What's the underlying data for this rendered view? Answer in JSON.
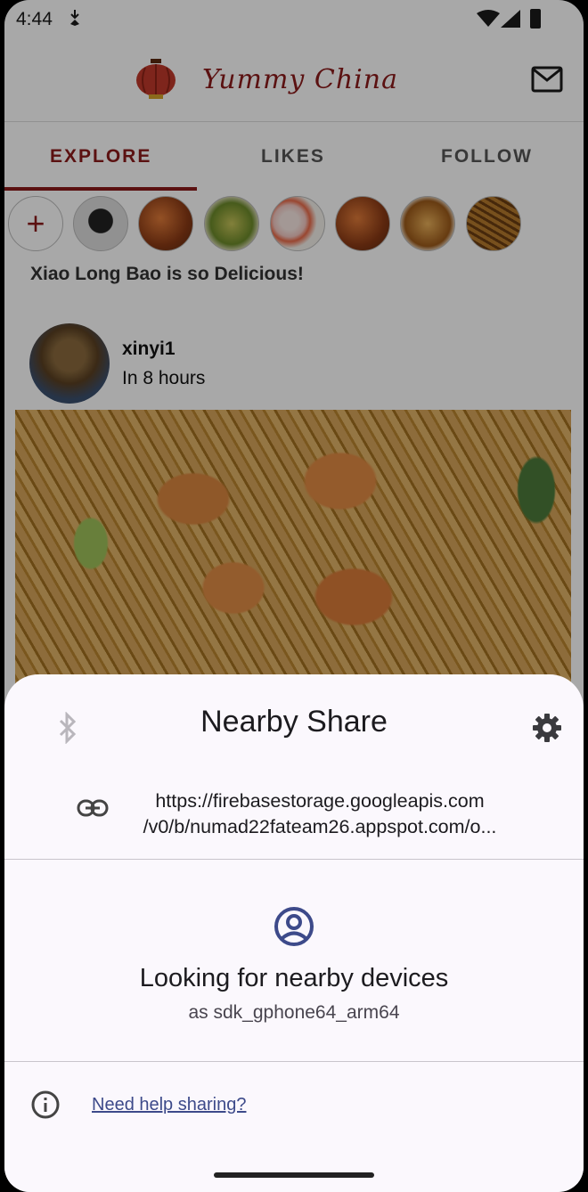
{
  "status_bar": {
    "time": "4:44"
  },
  "app": {
    "title": "Yummy China"
  },
  "tabs": [
    {
      "label": "EXPLORE",
      "active": true
    },
    {
      "label": "LIKES",
      "active": false
    },
    {
      "label": "FOLLOW",
      "active": false
    }
  ],
  "stories": {
    "add_label": "+"
  },
  "feed": {
    "caption": "Xiao Long Bao is so Delicious!",
    "post": {
      "username": "xinyi1",
      "time": "In 8 hours"
    }
  },
  "share_sheet": {
    "title": "Nearby Share",
    "link_line1": "https://firebasestorage.googleapis.com",
    "link_line2": "/v0/b/numad22fateam26.appspot.com/o...",
    "status": "Looking for nearby devices",
    "device": "as sdk_gphone64_arm64",
    "help_link": "Need help sharing?"
  },
  "colors": {
    "accent": "#8b1a1a",
    "sheet_bg": "#fbf8fd",
    "link": "#3d4a8a"
  }
}
